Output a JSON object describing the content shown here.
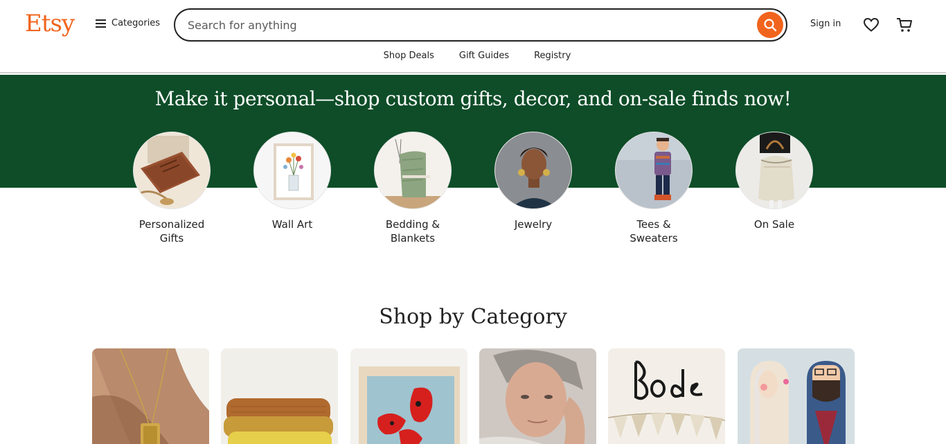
{
  "header": {
    "logo": "Etsy",
    "categories_label": "Categories",
    "search_placeholder": "Search for anything",
    "signin_label": "Sign in",
    "icons": [
      "menu-icon",
      "search-icon",
      "heart-icon",
      "cart-icon"
    ],
    "subnav": [
      "Shop Deals",
      "Gift Guides",
      "Registry"
    ]
  },
  "banner": {
    "headline": "Make it personal—shop custom gifts, decor, and on-sale finds now!",
    "color": "#0e4d28",
    "categories": [
      {
        "label_line1": "Personalized",
        "label_line2": "Gifts"
      },
      {
        "label_line1": "Wall Art",
        "label_line2": ""
      },
      {
        "label_line1": "Bedding &",
        "label_line2": "Blankets"
      },
      {
        "label_line1": "Jewelry",
        "label_line2": ""
      },
      {
        "label_line1": "Tees &",
        "label_line2": "Sweaters"
      },
      {
        "label_line1": "On Sale",
        "label_line2": ""
      }
    ]
  },
  "shop_by_category": {
    "title": "Shop by Category"
  },
  "colors": {
    "brand_orange": "#f1641e",
    "banner_green": "#0e4d28",
    "text": "#222222"
  }
}
